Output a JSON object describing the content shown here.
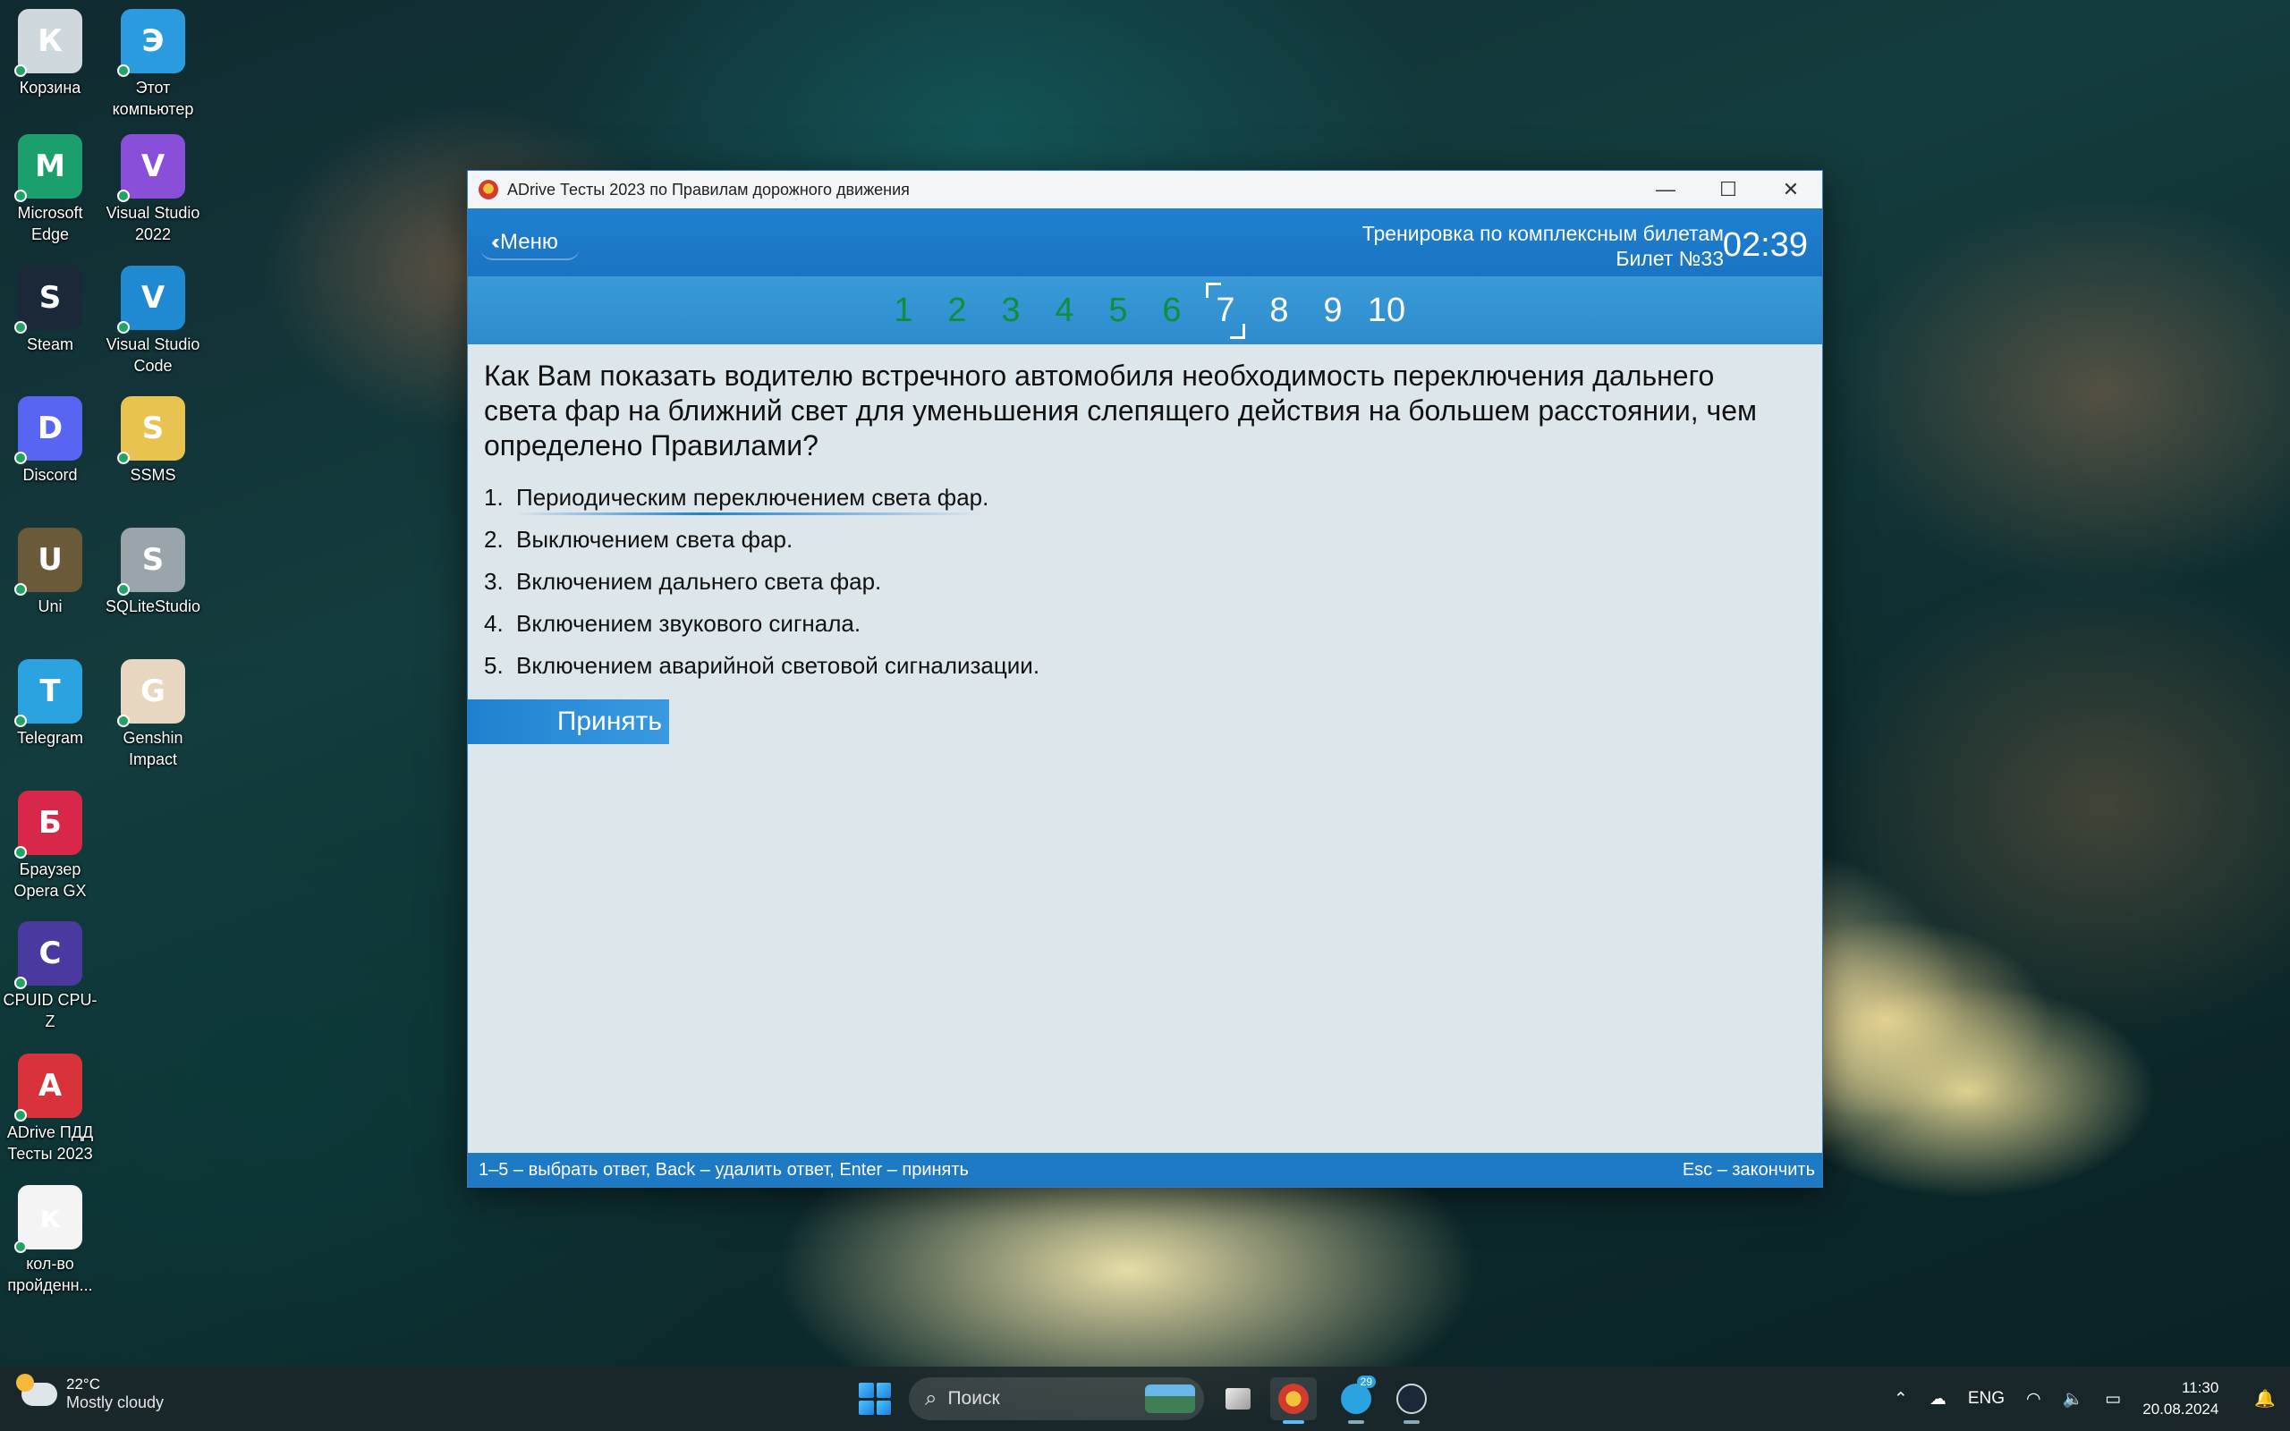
{
  "desktop": {
    "icons": [
      {
        "label": "Корзина",
        "icon": "recycle-bin-icon",
        "color": "#cfd8dc"
      },
      {
        "label": "Этот компьютер",
        "icon": "computer-icon",
        "color": "#2b9be0"
      },
      {
        "label": "Microsoft Edge",
        "icon": "edge-icon",
        "color": "#1b9f6c"
      },
      {
        "label": "Visual Studio 2022",
        "icon": "visual-studio-icon",
        "color": "#8a4fd8"
      },
      {
        "label": "Steam",
        "icon": "steam-icon",
        "color": "#1b2838"
      },
      {
        "label": "Visual Studio Code",
        "icon": "vscode-icon",
        "color": "#1f8ad2"
      },
      {
        "label": "Discord",
        "icon": "discord-icon",
        "color": "#5865f2"
      },
      {
        "label": "SSMS",
        "icon": "ssms-icon",
        "color": "#e8c350"
      },
      {
        "label": "Uni",
        "icon": "uni-icon",
        "color": "#6a5a3a"
      },
      {
        "label": "SQLiteStudio",
        "icon": "sqlitestudio-icon",
        "color": "#9aa4ab"
      },
      {
        "label": "Telegram",
        "icon": "telegram-icon",
        "color": "#2aa3e0"
      },
      {
        "label": "Genshin Impact",
        "icon": "genshin-icon",
        "color": "#e8d7c0"
      },
      {
        "label": "Браузер Opera GX",
        "icon": "opera-gx-icon",
        "color": "#d8284a"
      },
      {
        "label": "CPUID CPU-Z",
        "icon": "cpuz-icon",
        "color": "#4a3aa0"
      },
      {
        "label": "ADrive ПДД Тесты 2023",
        "icon": "adrive-icon",
        "color": "#d8323a"
      },
      {
        "label": "кол-во пройденн...",
        "icon": "document-icon",
        "color": "#f4f4f4"
      }
    ]
  },
  "window": {
    "title": "ADrive Тесты 2023 по Правилам дорожного движения",
    "minimize": "—",
    "maximize": "☐",
    "close": "✕",
    "menu_label": "Меню",
    "mode_label": "Тренировка по комплексным билетам",
    "ticket_label": "Билет №33",
    "timer": "02:39",
    "questions": [
      {
        "n": "1",
        "state": "answered"
      },
      {
        "n": "2",
        "state": "answered"
      },
      {
        "n": "3",
        "state": "answered"
      },
      {
        "n": "4",
        "state": "answered"
      },
      {
        "n": "5",
        "state": "answered"
      },
      {
        "n": "6",
        "state": "answered"
      },
      {
        "n": "7",
        "state": "current"
      },
      {
        "n": "8",
        "state": "pending"
      },
      {
        "n": "9",
        "state": "pending"
      },
      {
        "n": "10",
        "state": "pending"
      }
    ],
    "question": "Как Вам показать водителю встречного автомобиля необходимость переключения дальнего света фар на ближний свет для уменьшения слепящего действия на большем расстоянии, чем определено Правилами?",
    "answers": [
      {
        "n": "1.",
        "text": "Периодическим переключением света фар."
      },
      {
        "n": "2.",
        "text": "Выключением света фар."
      },
      {
        "n": "3.",
        "text": "Включением дальнего света фар."
      },
      {
        "n": "4.",
        "text": "Включением звукового сигнала."
      },
      {
        "n": "5.",
        "text": "Включением аварийной световой сигнализации."
      }
    ],
    "selected_answer": 1,
    "accept_label": "Принять",
    "status_left": "1–5 – выбрать ответ, Back – удалить ответ, Enter – принять",
    "status_right": "Esc – закончить"
  },
  "taskbar": {
    "weather_temp": "22°C",
    "weather_desc": "Mostly cloudy",
    "search_placeholder": "Поиск",
    "telegram_badge": "29",
    "language": "ENG",
    "time": "11:30",
    "date": "20.08.2024"
  },
  "colors": {
    "header_blue": "#1f80d0",
    "answered_green": "#0e8f3c",
    "status_blue": "#1f7ac6"
  }
}
